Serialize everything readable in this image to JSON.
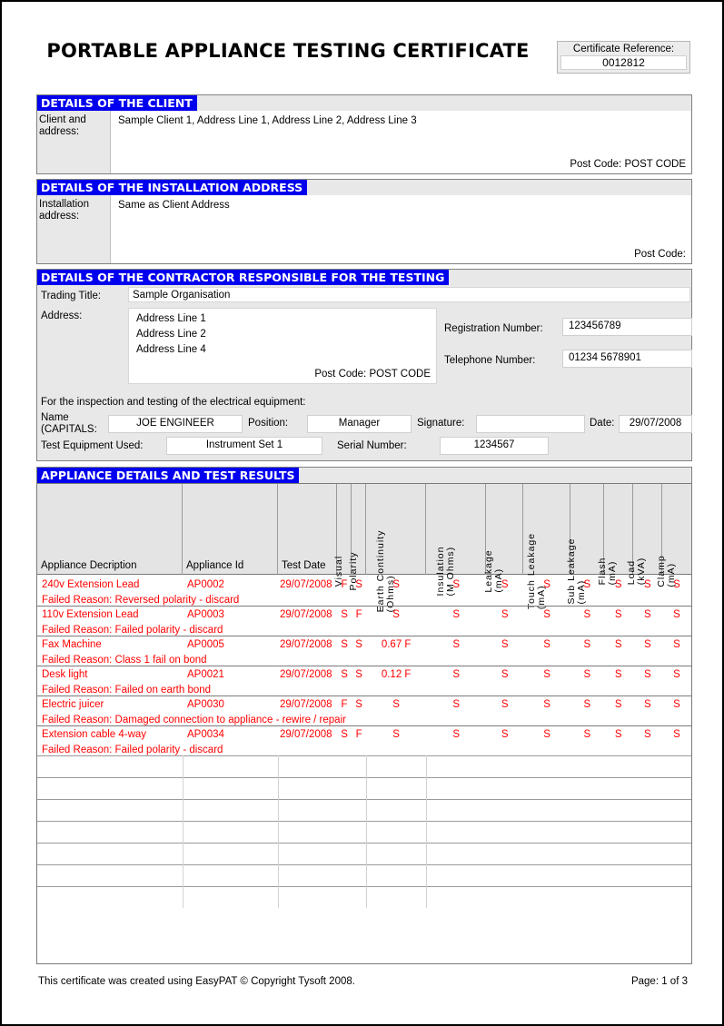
{
  "document": {
    "title": "PORTABLE APPLIANCE TESTING CERTIFICATE",
    "certificate_reference_label": "Certificate Reference:",
    "certificate_reference_value": "0012812"
  },
  "client_section": {
    "heading": "DETAILS OF THE CLIENT",
    "label": "Client and address:",
    "value": "Sample Client 1, Address Line 1, Address Line 2, Address Line 3",
    "postcode_label": "Post Code:",
    "postcode_value": "POST CODE"
  },
  "installation_section": {
    "heading": "DETAILS OF THE INSTALLATION ADDRESS",
    "label": "Installation address:",
    "value": "Same as Client Address",
    "postcode_label": "Post Code:",
    "postcode_value": ""
  },
  "contractor_section": {
    "heading": "DETAILS OF THE CONTRACTOR RESPONSIBLE FOR THE TESTING",
    "trading_title_label": "Trading Title:",
    "trading_title_value": "Sample Organisation",
    "address_label": "Address:",
    "address_line_1": "Address Line 1",
    "address_line_2": "Address Line 2",
    "address_line_3": "Address Line 4",
    "postcode_label": "Post Code:",
    "postcode_value": "POST CODE",
    "registration_label": "Registration Number:",
    "registration_value": "123456789",
    "telephone_label": "Telephone Number:",
    "telephone_value": "01234 5678901",
    "intro_text": "For the inspection and testing of the electrical equipment:",
    "name_label": "Name (CAPITALS:",
    "name_label_line1": "Name",
    "name_label_line2": "(CAPITALS:",
    "name_value": "JOE ENGINEER",
    "position_label": "Position:",
    "position_value": "Manager",
    "signature_label": "Signature:",
    "signature_value": "",
    "date_label": "Date:",
    "date_value": "29/07/2008",
    "test_equipment_label": "Test Equipment Used:",
    "test_equipment_value": "Instrument Set 1",
    "serial_label": "Serial Number:",
    "serial_value": "1234567"
  },
  "results_section": {
    "heading": "APPLIANCE DETAILS AND TEST RESULTS",
    "columns": [
      {
        "label": "Appliance Decription",
        "rotated": false
      },
      {
        "label": "Appliance Id",
        "rotated": false
      },
      {
        "label": "Test Date",
        "rotated": false
      },
      {
        "label": "Visual",
        "label2": "",
        "rotated": true
      },
      {
        "label": "Polarity",
        "label2": "",
        "rotated": true
      },
      {
        "label": "Earth Continuity",
        "label2": "(Ohms)",
        "rotated": true
      },
      {
        "label": "Insulation",
        "label2": "(M Ohms)",
        "rotated": true
      },
      {
        "label": "Leakage",
        "label2": "(mA)",
        "rotated": true
      },
      {
        "label": "Touch Leakage",
        "label2": "(mA)",
        "rotated": true
      },
      {
        "label": "Sub Leakage",
        "label2": "(mA)",
        "rotated": true
      },
      {
        "label": "Flash",
        "label2": "(mA)",
        "rotated": true
      },
      {
        "label": "Load",
        "label2": "(kVA)",
        "rotated": true
      },
      {
        "label": "Clamp",
        "label2": "(mA)",
        "rotated": true
      }
    ],
    "rows": [
      {
        "description": "240v Extension Lead",
        "appliance_id": "AP0002",
        "test_date": "29/07/2008",
        "visual": "F",
        "polarity": "S",
        "earth_continuity": "S",
        "insulation": "S",
        "leakage": "S",
        "touch_leakage": "S",
        "sub_leakage": "S",
        "flash": "S",
        "load": "S",
        "clamp": "S",
        "failed_reason": "Failed Reason: Reversed polarity - discard"
      },
      {
        "description": "110v Extension Lead",
        "appliance_id": "AP0003",
        "test_date": "29/07/2008",
        "visual": "S",
        "polarity": "F",
        "earth_continuity": "S",
        "insulation": "S",
        "leakage": "S",
        "touch_leakage": "S",
        "sub_leakage": "S",
        "flash": "S",
        "load": "S",
        "clamp": "S",
        "failed_reason": "Failed Reason: Failed polarity - discard"
      },
      {
        "description": "Fax Machine",
        "appliance_id": "AP0005",
        "test_date": "29/07/2008",
        "visual": "S",
        "polarity": "S",
        "earth_continuity": "0.67 F",
        "insulation": "S",
        "leakage": "S",
        "touch_leakage": "S",
        "sub_leakage": "S",
        "flash": "S",
        "load": "S",
        "clamp": "S",
        "failed_reason": "Failed Reason: Class 1 fail on bond"
      },
      {
        "description": "Desk light",
        "appliance_id": "AP0021",
        "test_date": "29/07/2008",
        "visual": "S",
        "polarity": "S",
        "earth_continuity": "0.12 F",
        "insulation": "S",
        "leakage": "S",
        "touch_leakage": "S",
        "sub_leakage": "S",
        "flash": "S",
        "load": "S",
        "clamp": "S",
        "failed_reason": "Failed Reason: Failed on earth bond"
      },
      {
        "description": "Electric juicer",
        "appliance_id": "AP0030",
        "test_date": "29/07/2008",
        "visual": "F",
        "polarity": "S",
        "earth_continuity": "S",
        "insulation": "S",
        "leakage": "S",
        "touch_leakage": "S",
        "sub_leakage": "S",
        "flash": "S",
        "load": "S",
        "clamp": "S",
        "failed_reason": "Failed Reason: Damaged connection to appliance - rewire / repair"
      },
      {
        "description": "Extension cable 4-way",
        "appliance_id": "AP0034",
        "test_date": "29/07/2008",
        "visual": "S",
        "polarity": "F",
        "earth_continuity": "S",
        "insulation": "S",
        "leakage": "S",
        "touch_leakage": "S",
        "sub_leakage": "S",
        "flash": "S",
        "load": "S",
        "clamp": "S",
        "failed_reason": "Failed Reason: Failed polarity - discard"
      }
    ],
    "empty_row_count": 7
  },
  "footer": {
    "left": "This certificate was created using EasyPAT © Copyright Tysoft 2008.",
    "right": "Page: 1 of 3"
  },
  "colors": {
    "heading_background": "#0000ee",
    "heading_text": "#ffffff",
    "section_background": "#e8e8e8",
    "result_text": "#ff0000",
    "border": "#808080"
  }
}
